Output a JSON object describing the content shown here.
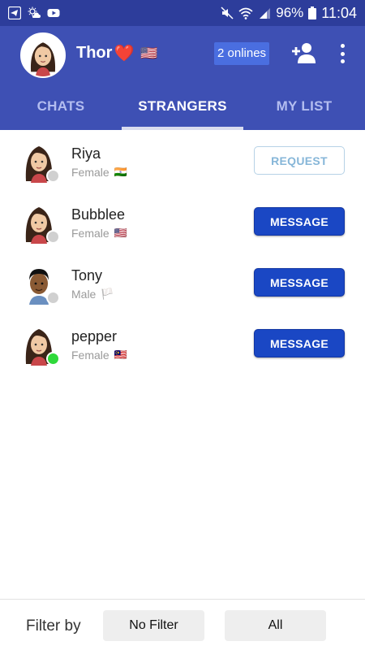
{
  "status_bar": {
    "battery": "96%",
    "time": "11:04"
  },
  "header": {
    "user_name": "Thor",
    "user_heart": "❤️",
    "user_flag": "🇺🇸",
    "onlines": "2 onlines"
  },
  "tabs": [
    {
      "label": "CHATS",
      "active": false
    },
    {
      "label": "STRANGERS",
      "active": true
    },
    {
      "label": "MY LIST",
      "active": false
    }
  ],
  "users": [
    {
      "name": "Riya",
      "gender": "Female",
      "flag": "🇮🇳",
      "online": false,
      "action": "REQUEST",
      "skin": "#f0c9a4",
      "hair": "#3a2418"
    },
    {
      "name": "Bubblee",
      "gender": "Female",
      "flag": "🇺🇸",
      "online": false,
      "action": "MESSAGE",
      "skin": "#f0c9a4",
      "hair": "#3a2418"
    },
    {
      "name": "Tony",
      "gender": "Male",
      "flag": "🏳️",
      "online": false,
      "action": "MESSAGE",
      "skin": "#8a5a34",
      "hair": "#111111"
    },
    {
      "name": "pepper",
      "gender": "Female",
      "flag": "🇲🇾",
      "online": true,
      "action": "MESSAGE",
      "skin": "#f0c9a4",
      "hair": "#3a2418"
    }
  ],
  "footer": {
    "filter_label": "Filter by",
    "filter_gender": "No Filter",
    "filter_country": "All"
  },
  "colors": {
    "header": "#3e50b4",
    "status_bar": "#2d3d9b",
    "message_button": "#1a47c4",
    "online": "#2fd93a"
  }
}
